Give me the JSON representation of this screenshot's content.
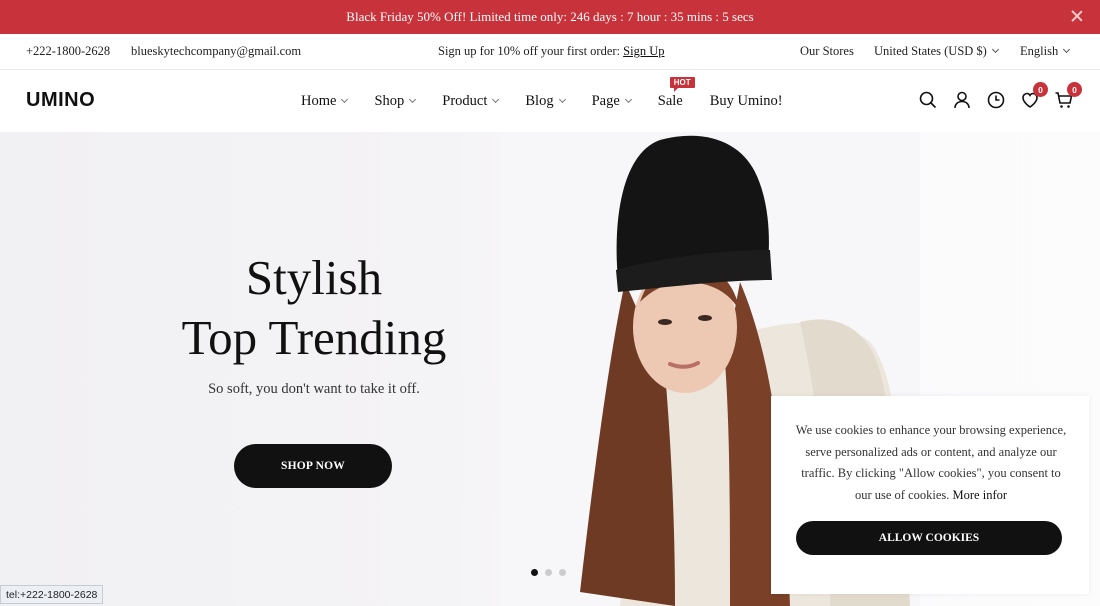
{
  "announcement": {
    "text": "Black Friday 50% Off! Limited time only:   246 days : 7 hour : 35 mins : 5 secs",
    "close_icon": "close-icon"
  },
  "topbar": {
    "phone": "+222-1800-2628",
    "email": "blueskytechcompany@gmail.com",
    "promo_text": "Sign up for 10% off your first order: ",
    "promo_link": "Sign Up",
    "stores": "Our Stores",
    "currency": "United States (USD $)",
    "language": "English"
  },
  "header": {
    "logo": "UMINO",
    "nav": [
      {
        "label": "Home"
      },
      {
        "label": "Shop"
      },
      {
        "label": "Product"
      },
      {
        "label": "Blog"
      },
      {
        "label": "Page"
      },
      {
        "label": "Sale",
        "badge": "HOT"
      },
      {
        "label": "Buy Umino!"
      }
    ],
    "icons": [
      "search-icon",
      "user-icon",
      "clock-icon",
      "heart-icon",
      "cart-icon"
    ],
    "wishlist_count": "0",
    "cart_count": "0"
  },
  "hero": {
    "title_line1": "Stylish",
    "title_line2": "Top Trending",
    "subtitle": "So soft, you don't want to take it off.",
    "button": "SHOP NOW",
    "slide_count": 3,
    "active_slide": 1
  },
  "cookie": {
    "text": "We use cookies to enhance your browsing experience, serve personalized ads or content, and analyze our traffic. By clicking \"Allow cookies\", you consent to our use of cookies. ",
    "more_link": "More infor",
    "button": "ALLOW COOKIES"
  },
  "status_bar": "tel:+222-1800-2628",
  "colors": {
    "accent": "#c8323a",
    "dark": "#111111"
  }
}
